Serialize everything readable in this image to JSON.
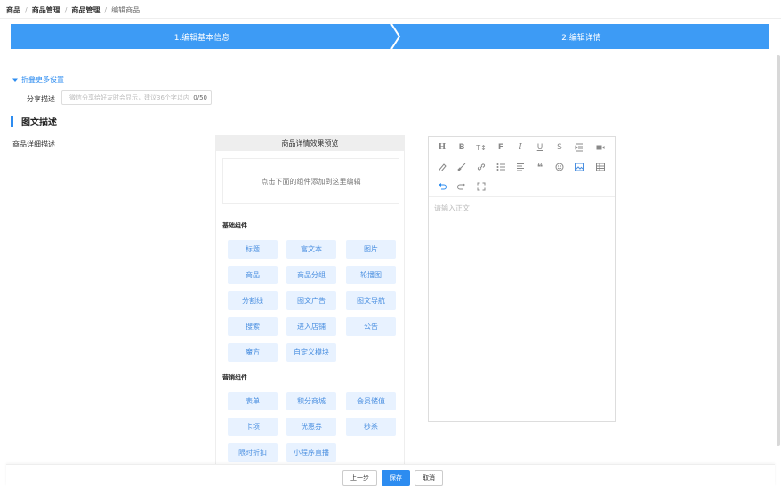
{
  "breadcrumb": [
    "商品",
    "商品管理",
    "商品管理",
    "编辑商品"
  ],
  "steps": {
    "step1": "1.编辑基本信息",
    "step2": "2.编辑详情"
  },
  "fold_label": "折叠更多设置",
  "share": {
    "label": "分享描述",
    "placeholder": "微信分享给好友时会显示，建议36个字以内",
    "count": "0/50"
  },
  "section_title": "图文描述",
  "detail_label": "商品详细描述",
  "preview": {
    "title": "商品详情效果预览",
    "drop_hint": "点击下面的组件添加到这里编辑",
    "basic_title": "基础组件",
    "basic": [
      "标题",
      "富文本",
      "图片",
      "商品",
      "商品分组",
      "轮播图",
      "分割线",
      "图文广告",
      "图文导航",
      "搜索",
      "进入店铺",
      "公告",
      "魔方",
      "自定义模块"
    ],
    "marketing_title": "营销组件",
    "marketing": [
      "表单",
      "积分商城",
      "会员储值",
      "卡项",
      "优惠券",
      "秒杀",
      "限时折扣",
      "小程序直播"
    ]
  },
  "editor": {
    "placeholder": "请输入正文",
    "toolbar": {
      "row1": [
        "H",
        "B",
        "T↕",
        "F",
        "I",
        "U",
        "S"
      ],
      "icons": [
        "heading-icon",
        "bold-icon",
        "font-size-icon",
        "font-family-icon",
        "italic-icon",
        "underline-icon",
        "strikethrough-icon",
        "indent-icon",
        "video-icon",
        "eraser-icon",
        "brush-icon",
        "link-icon",
        "list-icon",
        "align-icon",
        "quote-icon",
        "emoji-icon",
        "image-icon",
        "table-icon",
        "undo-icon",
        "redo-icon",
        "fullscreen-icon"
      ]
    }
  },
  "footer": {
    "prev": "上一步",
    "save": "保存",
    "cancel": "取消"
  },
  "colors": {
    "accent": "#2d8cf0",
    "step": "#3d9bf5",
    "comp_bg": "#e8f2ff"
  }
}
